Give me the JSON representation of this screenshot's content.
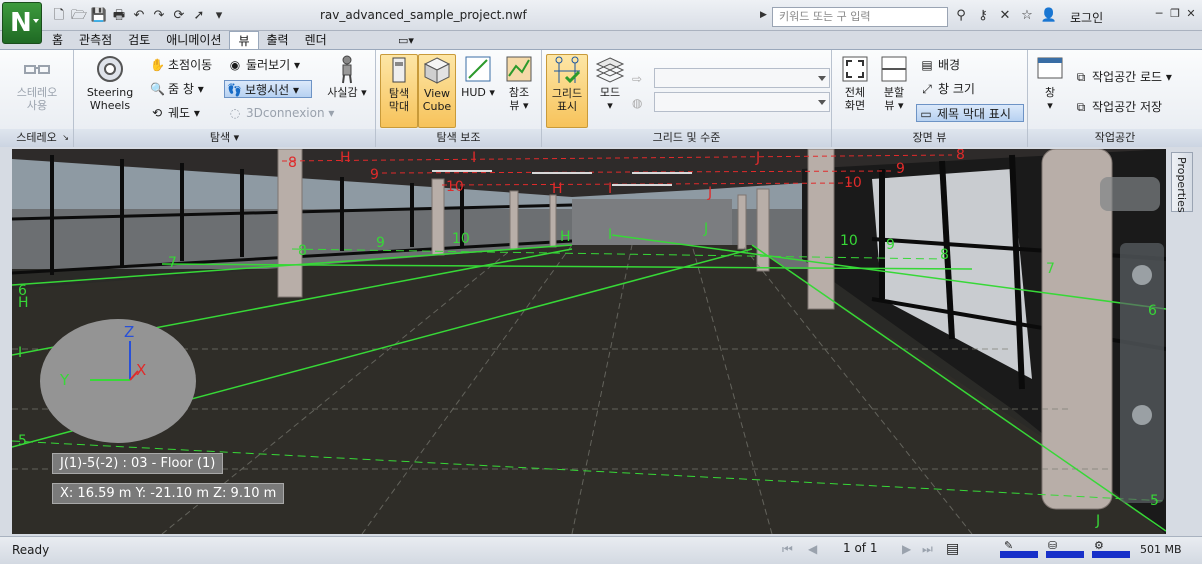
{
  "app": {
    "document_title": "rav_advanced_sample_project.nwf",
    "search_placeholder": "키워드 또는 구 입력",
    "login_label": "로그인"
  },
  "tabs": [
    {
      "label": "홈"
    },
    {
      "label": "관측점"
    },
    {
      "label": "검토"
    },
    {
      "label": "애니메이션"
    },
    {
      "label": "뷰",
      "active": true
    },
    {
      "label": "출력"
    },
    {
      "label": "렌더"
    }
  ],
  "ribbon": {
    "stereo": {
      "title": "스테레오",
      "button_label_1": "스테레오",
      "button_label_2": "사용"
    },
    "navigate": {
      "title": "탐색",
      "steering_label_1": "Steering",
      "steering_label_2": "Wheels",
      "pan": "초점이동",
      "zoom": "줌 창",
      "orbit": "궤도",
      "look_around": "둘러보기",
      "walk": "보행시선",
      "connexion": "3Dconnexion",
      "realism": "사실감"
    },
    "navigation_aids": {
      "title": "탐색 보조",
      "nav_bar_1": "탐색",
      "nav_bar_2": "막대",
      "viewcube_1": "View",
      "viewcube_2": "Cube",
      "hud": "HUD",
      "reference_1": "참조",
      "reference_2": "뷰"
    },
    "grids_levels": {
      "title": "그리드 및 수준",
      "show_grid_1": "그리드",
      "show_grid_2": "표시",
      "mode": "모드"
    },
    "scene_view": {
      "title": "장면 뷰",
      "fullscreen_1": "전체",
      "fullscreen_2": "화면",
      "split_1": "분할",
      "split_2": "뷰",
      "background": "배경",
      "window_size": "창 크기",
      "show_title_bar": "제목 막대 표시"
    },
    "workspace": {
      "title": "작업공간",
      "windows": "창",
      "load_workspace": "작업공간 로드",
      "save_workspace": "작업공간 저장"
    }
  },
  "viewport": {
    "location_label": "J(1)-5(-2) : 03 - Floor (1)",
    "coords_label": "X: 16.59 m  Y: -21.10 m  Z: 9.10 m",
    "axis_x": "X",
    "axis_y": "Y",
    "axis_z": "Z",
    "grid_labels_red": [
      "8",
      "H",
      "9",
      "I",
      "10",
      "H",
      "I",
      "J",
      "J",
      "8",
      "9",
      "10"
    ],
    "grid_labels_green": [
      "7",
      "6",
      "H",
      "I",
      "5",
      "8",
      "9",
      "10",
      "H",
      "I",
      "J",
      "10",
      "9",
      "8",
      "7",
      "6",
      "5",
      "J"
    ],
    "properties_tab": "Properties"
  },
  "status": {
    "text": "Ready",
    "page_info": "1 of 1",
    "memory": "501 MB"
  },
  "colors": {
    "grid_green": "#37d837",
    "grid_red": "#e02a2a",
    "app_button": "#2b7d2f",
    "meter_blue": "#1730c9"
  }
}
